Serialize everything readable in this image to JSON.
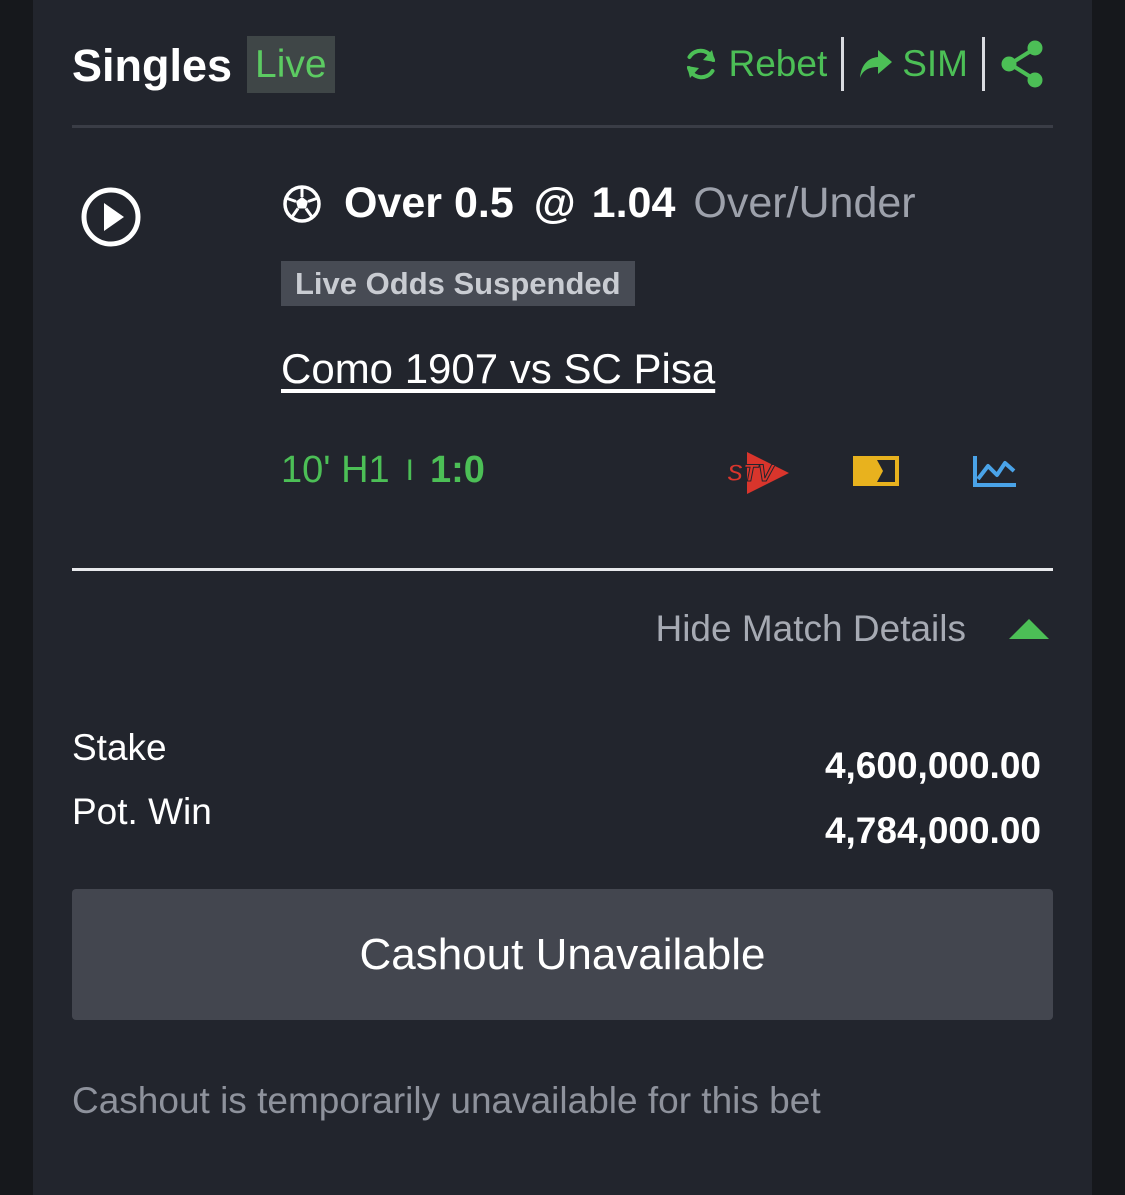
{
  "header": {
    "title": "Singles",
    "badge": "Live",
    "rebet_label": "Rebet",
    "sim_label": "SIM"
  },
  "bet": {
    "selection": "Over 0.5",
    "at": "@",
    "odds": "1.04",
    "market": "Over/Under",
    "suspended_badge": "Live Odds Suspended",
    "match": "Como 1907 vs SC Pisa",
    "time": "10' H1",
    "separator": "I",
    "score": "1:0",
    "stv_logo_text": "STV"
  },
  "details": {
    "toggle_label": "Hide Match Details",
    "stake_label": "Stake",
    "stake_value": "4,600,000.00",
    "potwin_label": "Pot. Win",
    "potwin_value": "4,784,000.00"
  },
  "cashout": {
    "button_label": "Cashout Unavailable",
    "note": "Cashout is temporarily unavailable for this bet"
  },
  "colors": {
    "accent_green": "#4cbf56",
    "stv_red": "#d9352c",
    "match_tracker_yellow": "#e8b21e",
    "stats_blue": "#4aa3e8"
  }
}
